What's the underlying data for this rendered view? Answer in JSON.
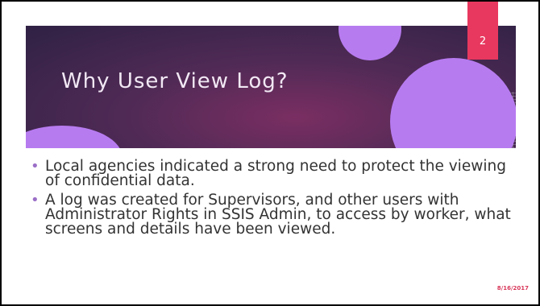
{
  "slide": {
    "title": "Why User View Log?",
    "page_number": "2",
    "bullets": [
      "Local agencies indicated a strong need to protect the viewing of confidential data.",
      "A log  was created for Supervisors, and other users with Administrator Rights in SSIS Admin, to access  by worker, what screens and details have been viewed."
    ],
    "date": "8/16/2017",
    "bullet_glyph": "•"
  },
  "colors": {
    "banner": "#4f2a55",
    "circles": "#b77bf0",
    "page_number_box": "#e8385f",
    "bullet_mark": "#9b6fc7",
    "date": "#d8385a"
  }
}
